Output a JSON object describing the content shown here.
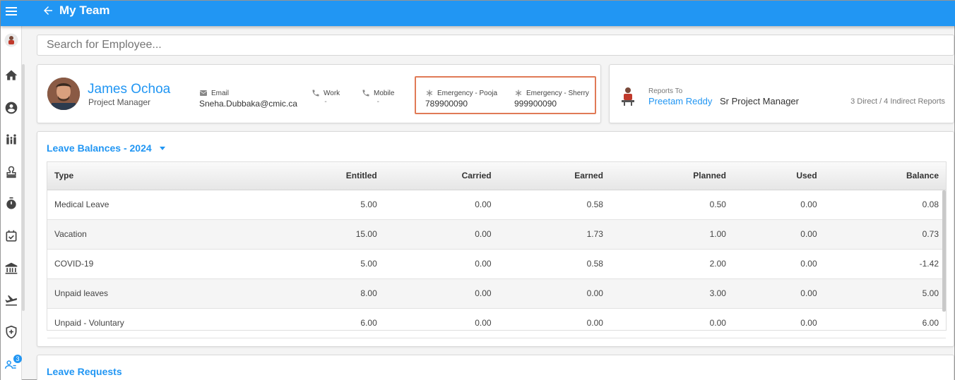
{
  "header": {
    "title": "My Team"
  },
  "search": {
    "placeholder": "Search for Employee..."
  },
  "employee": {
    "name": "James Ochoa",
    "role": "Project Manager",
    "email_label": "Email",
    "email": "Sneha.Dubbaka@cmic.ca",
    "work_label": "Work",
    "work_value": "-",
    "mobile_label": "Mobile",
    "mobile_value": "-",
    "emergency": [
      {
        "label": "Emergency - Pooja",
        "value": "789900090"
      },
      {
        "label": "Emergency - Sherry",
        "value": "999900090"
      }
    ]
  },
  "manager": {
    "reports_to_label": "Reports To",
    "name": "Preetam Reddy",
    "title": "Sr Project Manager",
    "reports_count": "3 Direct / 4 Indirect Reports"
  },
  "leave_balances": {
    "title": "Leave Balances - 2024",
    "columns": [
      "Type",
      "Entitled",
      "Carried",
      "Earned",
      "Planned",
      "Used",
      "Balance"
    ],
    "rows": [
      [
        "Medical Leave",
        "5.00",
        "0.00",
        "0.58",
        "0.50",
        "0.00",
        "0.08"
      ],
      [
        "Vacation",
        "15.00",
        "0.00",
        "1.73",
        "1.00",
        "0.00",
        "0.73"
      ],
      [
        "COVID-19",
        "5.00",
        "0.00",
        "0.58",
        "2.00",
        "0.00",
        "-1.42"
      ],
      [
        "Unpaid leaves",
        "8.00",
        "0.00",
        "0.00",
        "3.00",
        "0.00",
        "5.00"
      ],
      [
        "Unpaid - Voluntary",
        "6.00",
        "0.00",
        "0.00",
        "0.00",
        "0.00",
        "6.00"
      ]
    ]
  },
  "leave_requests": {
    "title": "Leave Requests"
  },
  "sidebar": {
    "notification_count": "3"
  },
  "colors": {
    "primary": "#2196f3",
    "highlight_border": "#e07a56"
  }
}
